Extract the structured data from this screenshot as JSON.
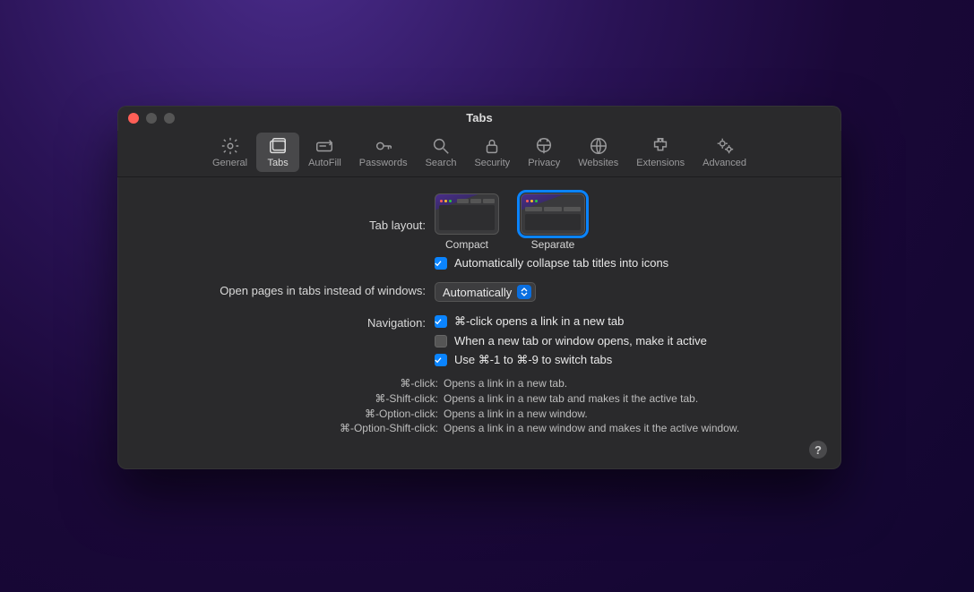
{
  "window": {
    "title": "Tabs"
  },
  "toolbar": {
    "items": [
      {
        "id": "general",
        "label": "General"
      },
      {
        "id": "tabs",
        "label": "Tabs"
      },
      {
        "id": "autofill",
        "label": "AutoFill"
      },
      {
        "id": "passwords",
        "label": "Passwords"
      },
      {
        "id": "search",
        "label": "Search"
      },
      {
        "id": "security",
        "label": "Security"
      },
      {
        "id": "privacy",
        "label": "Privacy"
      },
      {
        "id": "websites",
        "label": "Websites"
      },
      {
        "id": "extensions",
        "label": "Extensions"
      },
      {
        "id": "advanced",
        "label": "Advanced"
      }
    ],
    "active": "tabs"
  },
  "labels": {
    "tab_layout": "Tab layout:",
    "open_pages": "Open pages in tabs instead of windows:",
    "navigation": "Navigation:"
  },
  "tab_layout": {
    "compact": "Compact",
    "separate": "Separate",
    "selected": "separate",
    "collapse_icons": "Automatically collapse tab titles into icons",
    "collapse_icons_checked": true
  },
  "open_pages_select": {
    "value": "Automatically"
  },
  "navigation": {
    "cmd_click": {
      "label": "⌘-click opens a link in a new tab",
      "checked": true
    },
    "make_active": {
      "label": "When a new tab or window opens, make it active",
      "checked": false
    },
    "switch_tabs": {
      "label": "Use ⌘-1 to ⌘-9 to switch tabs",
      "checked": true
    }
  },
  "hints": [
    {
      "k": "⌘-click:",
      "v": "Opens a link in a new tab."
    },
    {
      "k": "⌘-Shift-click:",
      "v": "Opens a link in a new tab and makes it the active tab."
    },
    {
      "k": "⌘-Option-click:",
      "v": "Opens a link in a new window."
    },
    {
      "k": "⌘-Option-Shift-click:",
      "v": "Opens a link in a new window and makes it the active window."
    }
  ],
  "help": "?"
}
